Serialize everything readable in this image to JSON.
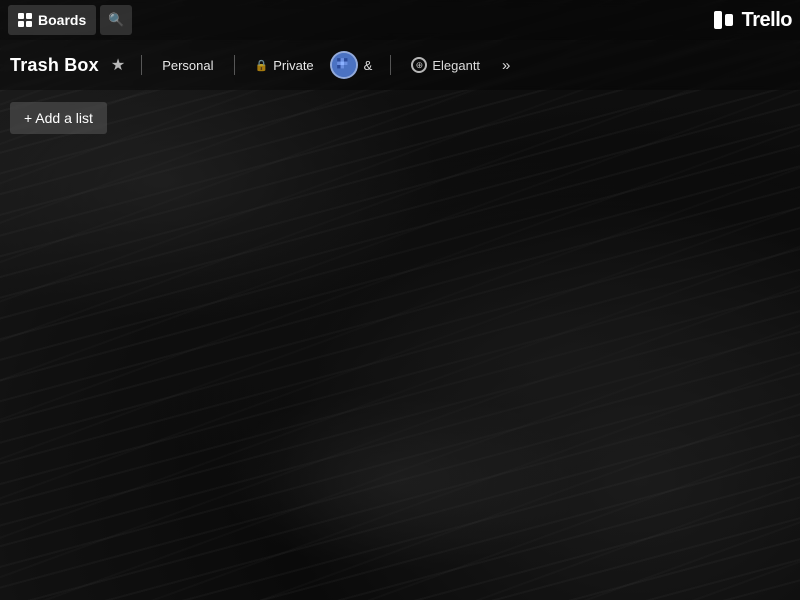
{
  "topbar": {
    "boards_label": "Boards",
    "search_placeholder": "Search",
    "trello_logo": "Trello"
  },
  "board_header": {
    "title": "Trash Box",
    "star_icon": "★",
    "workspace_personal": "Personal",
    "workspace_private": "Private",
    "and_more": "&",
    "elegantt_label": "Elegantt",
    "more_icon": "»"
  },
  "board_content": {
    "add_list_label": "+ Add a list"
  },
  "colors": {
    "topbar_bg": "rgba(0,0,0,0.5)",
    "board_header_bg": "rgba(0,0,0,0.35)",
    "text_white": "#ffffff",
    "accent_blue": "#4b72c2"
  }
}
